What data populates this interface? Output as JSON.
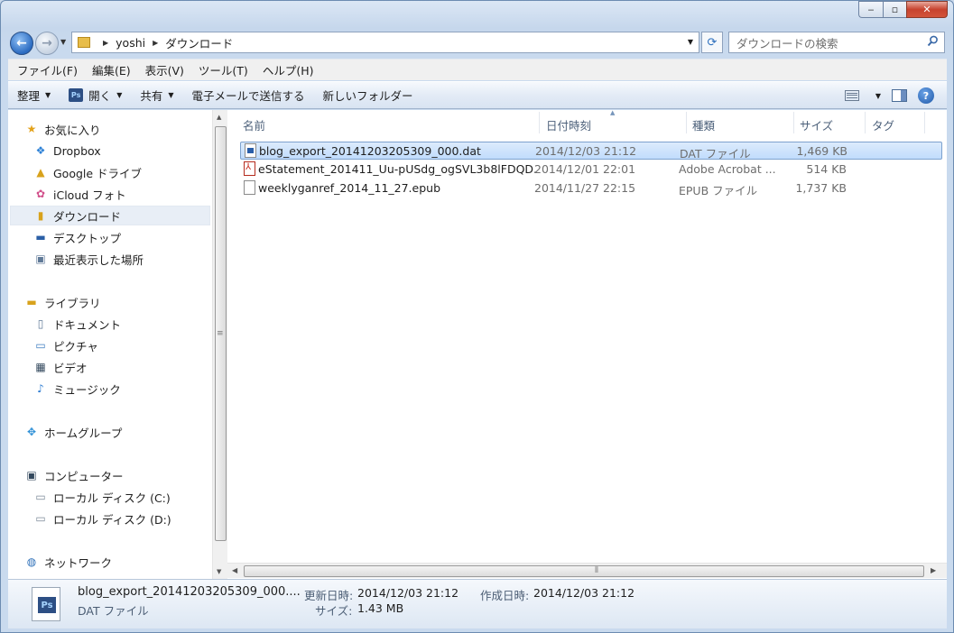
{
  "window": {
    "controls": {
      "minimize": "‒",
      "maximize": "▫",
      "close": "✕"
    }
  },
  "address": {
    "crumbs": [
      "yoshi",
      "ダウンロード"
    ],
    "search_placeholder": "ダウンロードの検索"
  },
  "menu": [
    "ファイル(F)",
    "編集(E)",
    "表示(V)",
    "ツール(T)",
    "ヘルプ(H)"
  ],
  "commands": {
    "organize": "整理",
    "open": "開く",
    "share": "共有",
    "email": "電子メールで送信する",
    "new_folder": "新しいフォルダー"
  },
  "nav": {
    "favorites": "お気に入り",
    "dropbox": "Dropbox",
    "google_drive": "Google ドライブ",
    "icloud_photos": "iCloud フォト",
    "downloads": "ダウンロード",
    "desktop": "デスクトップ",
    "recent": "最近表示した場所",
    "libraries": "ライブラリ",
    "documents": "ドキュメント",
    "pictures": "ピクチャ",
    "videos": "ビデオ",
    "music": "ミュージック",
    "homegroup": "ホームグループ",
    "computer": "コンピューター",
    "disk_c": "ローカル ディスク (C:)",
    "disk_d": "ローカル ディスク (D:)",
    "network": "ネットワーク"
  },
  "columns": {
    "name": "名前",
    "date": "日付時刻",
    "type": "種類",
    "size": "サイズ",
    "tags": "タグ"
  },
  "files": [
    {
      "name": "blog_export_20141203205309_000.dat",
      "date": "2014/12/03 21:12",
      "type": "DAT ファイル",
      "size": "1,469 KB",
      "icon": "dat-file-icon"
    },
    {
      "name": "eStatement_201411_Uu-pUSdg_ogSVL3b8lFDQD...",
      "date": "2014/12/01 22:01",
      "type": "Adobe Acrobat ...",
      "size": "514 KB",
      "icon": "pdf-file-icon"
    },
    {
      "name": "weeklyganref_2014_11_27.epub",
      "date": "2014/11/27 22:15",
      "type": "EPUB ファイル",
      "size": "1,737 KB",
      "icon": "generic-file-icon"
    }
  ],
  "details": {
    "name": "blog_export_20141203205309_000....",
    "type": "DAT ファイル",
    "modified_label": "更新日時:",
    "modified_value": "2014/12/03 21:12",
    "created_label": "作成日時:",
    "created_value": "2014/12/03 21:12",
    "size_label": "サイズ:",
    "size_value": "1.43 MB"
  }
}
